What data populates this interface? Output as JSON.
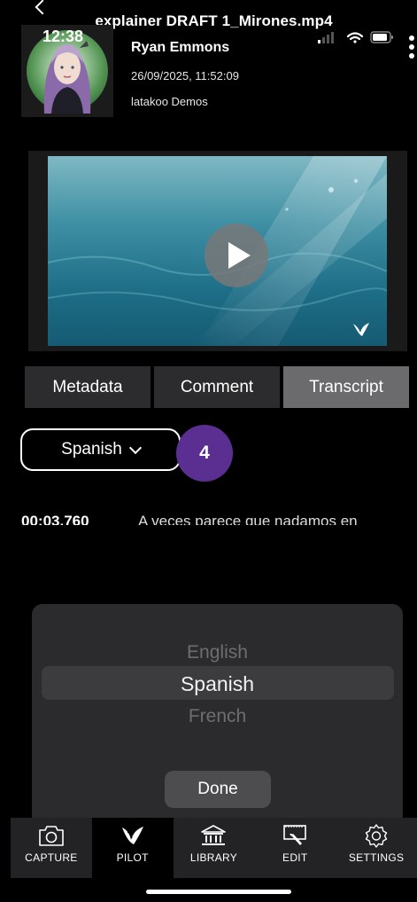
{
  "window": {
    "title": "explainer DRAFT 1_Mirones.mp4"
  },
  "status_bar": {
    "time": "12:38"
  },
  "header": {
    "user_name": "Ryan Emmons",
    "date": "26/09/2025, 11:52:09",
    "group": "latakoo Demos"
  },
  "tabs": [
    {
      "label": "Metadata",
      "active": false
    },
    {
      "label": "Comment",
      "active": false
    },
    {
      "label": "Transcript",
      "active": true
    }
  ],
  "language": {
    "selected": "Spanish"
  },
  "step_badge": "4",
  "transcript": [
    {
      "timestamp": "00:03.760",
      "text": "A veces parece que nadamos en"
    }
  ],
  "picker": {
    "options": [
      "English",
      "Spanish",
      "French"
    ],
    "selected": "Spanish",
    "done_label": "Done"
  },
  "bottom_nav": [
    {
      "label": "CAPTURE",
      "icon": "camera-icon",
      "active": false
    },
    {
      "label": "PILOT",
      "icon": "bird-logo-icon",
      "active": true
    },
    {
      "label": "LIBRARY",
      "icon": "library-building-icon",
      "active": false
    },
    {
      "label": "EDIT",
      "icon": "edit-frame-icon",
      "active": false
    },
    {
      "label": "SETTINGS",
      "icon": "gear-icon",
      "active": false
    }
  ],
  "colors": {
    "step_badge": "#5b2f91",
    "active_tab": "#6b6b6d",
    "tab": "#2c2c2e",
    "picker_panel": "#2b2b2d"
  }
}
